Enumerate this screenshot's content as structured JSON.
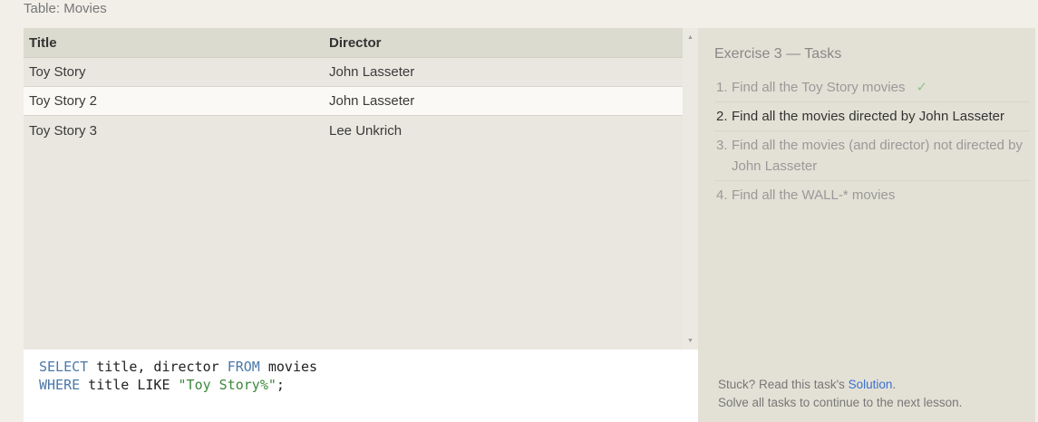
{
  "table_caption": "Table: Movies",
  "results": {
    "columns": [
      "Title",
      "Director"
    ],
    "rows": [
      [
        "Toy Story",
        "John Lasseter"
      ],
      [
        "Toy Story 2",
        "John Lasseter"
      ],
      [
        "Toy Story 3",
        "Lee Unkrich"
      ]
    ]
  },
  "scrollbar": {
    "up_glyph": "▲",
    "down_glyph": "▼"
  },
  "query": {
    "line1": {
      "kw1": "SELECT",
      "text1": " title, director ",
      "kw2": "FROM",
      "text2": " movies"
    },
    "line2": {
      "kw1": "WHERE",
      "text1": " title LIKE ",
      "string": "\"Toy Story%\"",
      "text2": ";"
    }
  },
  "tasks": {
    "title": "Exercise 3 — Tasks",
    "items": [
      {
        "num": "1.",
        "text": "Find all the Toy Story movies",
        "check": "✓"
      },
      {
        "num": "2.",
        "text": "Find all the movies directed by John Lasseter"
      },
      {
        "num": "3.",
        "text": "Find all the movies (and director) not directed by John Lasseter"
      },
      {
        "num": "4.",
        "text": "Find all the WALL-* movies"
      }
    ]
  },
  "help": {
    "prefix": "Stuck? Read this task's ",
    "link": "Solution",
    "suffix": ".",
    "line2": "Solve all tasks to continue to the next lesson."
  },
  "colors": {
    "keyword": "#4a78a8",
    "string": "#3c8a3c",
    "link": "#3a6fd0",
    "check": "#8fc48f"
  }
}
